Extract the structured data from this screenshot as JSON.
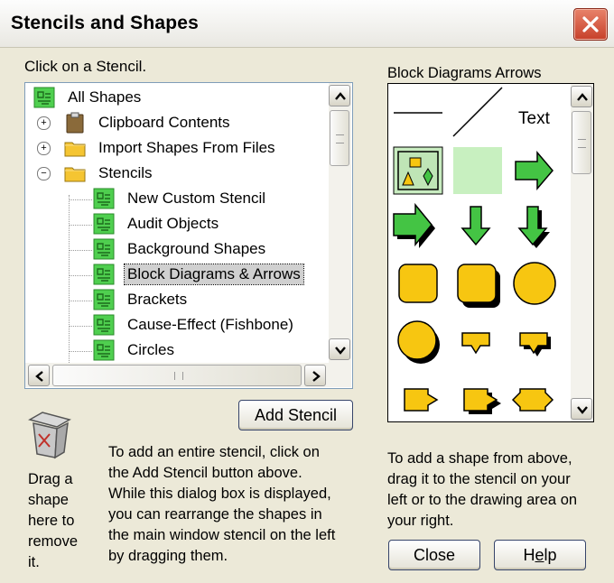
{
  "window": {
    "title": "Stencils and Shapes"
  },
  "stencil_list": {
    "label": "Click on a Stencil.",
    "items": [
      {
        "label": "All Shapes",
        "icon": "stencil-icon",
        "level": 0,
        "expander": ""
      },
      {
        "label": "Clipboard Contents",
        "icon": "clipboard-icon",
        "level": 1,
        "expander": "+"
      },
      {
        "label": "Import Shapes From Files",
        "icon": "folder-icon",
        "level": 1,
        "expander": "+"
      },
      {
        "label": "Stencils",
        "icon": "folder-icon",
        "level": 1,
        "expander": "−"
      },
      {
        "label": "New Custom Stencil",
        "icon": "stencil-icon",
        "level": 2
      },
      {
        "label": "Audit Objects",
        "icon": "stencil-icon",
        "level": 2
      },
      {
        "label": "Background Shapes",
        "icon": "stencil-icon",
        "level": 2
      },
      {
        "label": "Block Diagrams & Arrows",
        "icon": "stencil-icon",
        "level": 2,
        "selected": true
      },
      {
        "label": "Brackets",
        "icon": "stencil-icon",
        "level": 2
      },
      {
        "label": "Cause-Effect (Fishbone)",
        "icon": "stencil-icon",
        "level": 2
      },
      {
        "label": "Circles",
        "icon": "stencil-icon",
        "level": 2
      }
    ]
  },
  "add_stencil_button": {
    "label": "Add Stencil"
  },
  "trash": {
    "icon": "trash-can-icon",
    "text_lines": [
      "Drag a",
      "shape",
      "here to",
      "remove",
      "it."
    ]
  },
  "add_stencil_help": {
    "lines": [
      "To add an entire stencil, click on",
      "the Add Stencil button above.",
      "While this dialog box is displayed,",
      "you can rearrange the shapes in",
      "the main window stencil on the left",
      "by dragging them."
    ]
  },
  "preview": {
    "label": "Block Diagrams Arrows",
    "text_shape_label": "Text",
    "colors": {
      "green": "#44c444",
      "yellow": "#f7c611",
      "light_green": "#c8f0c0",
      "selected_bg": "#c8ecc0"
    }
  },
  "add_shape_help": {
    "lines": [
      "To add a shape from above,",
      "drag it to the stencil on your",
      "left or to the drawing area on",
      "your right."
    ]
  },
  "close_button": {
    "label": "Close"
  },
  "help_button": {
    "label_pre": "H",
    "label_underline": "e",
    "label_post": "lp"
  }
}
